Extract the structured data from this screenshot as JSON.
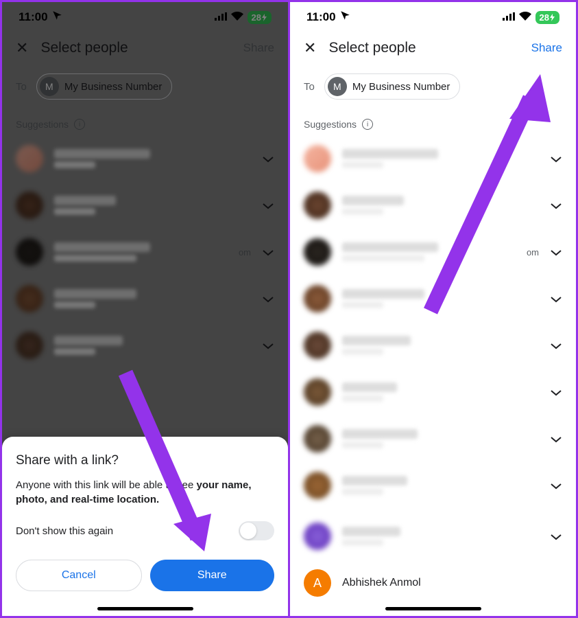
{
  "statusBar": {
    "time": "11:00",
    "battery": "28"
  },
  "header": {
    "title": "Select people",
    "shareLabel": "Share"
  },
  "to": {
    "label": "To",
    "chipInitial": "M",
    "chipLabel": "My Business Number"
  },
  "suggestions": {
    "label": "Suggestions"
  },
  "visibleText": {
    "om": "om"
  },
  "lastContact": {
    "initial": "A",
    "name": "Abhishek Anmol"
  },
  "sheet": {
    "title": "Share with a link?",
    "bodyPrefix": "Anyone with this link will be able to see ",
    "bodyBold": "your name, photo, and real-time location.",
    "dontShow": "Don't show this again",
    "cancel": "Cancel",
    "share": "Share"
  }
}
